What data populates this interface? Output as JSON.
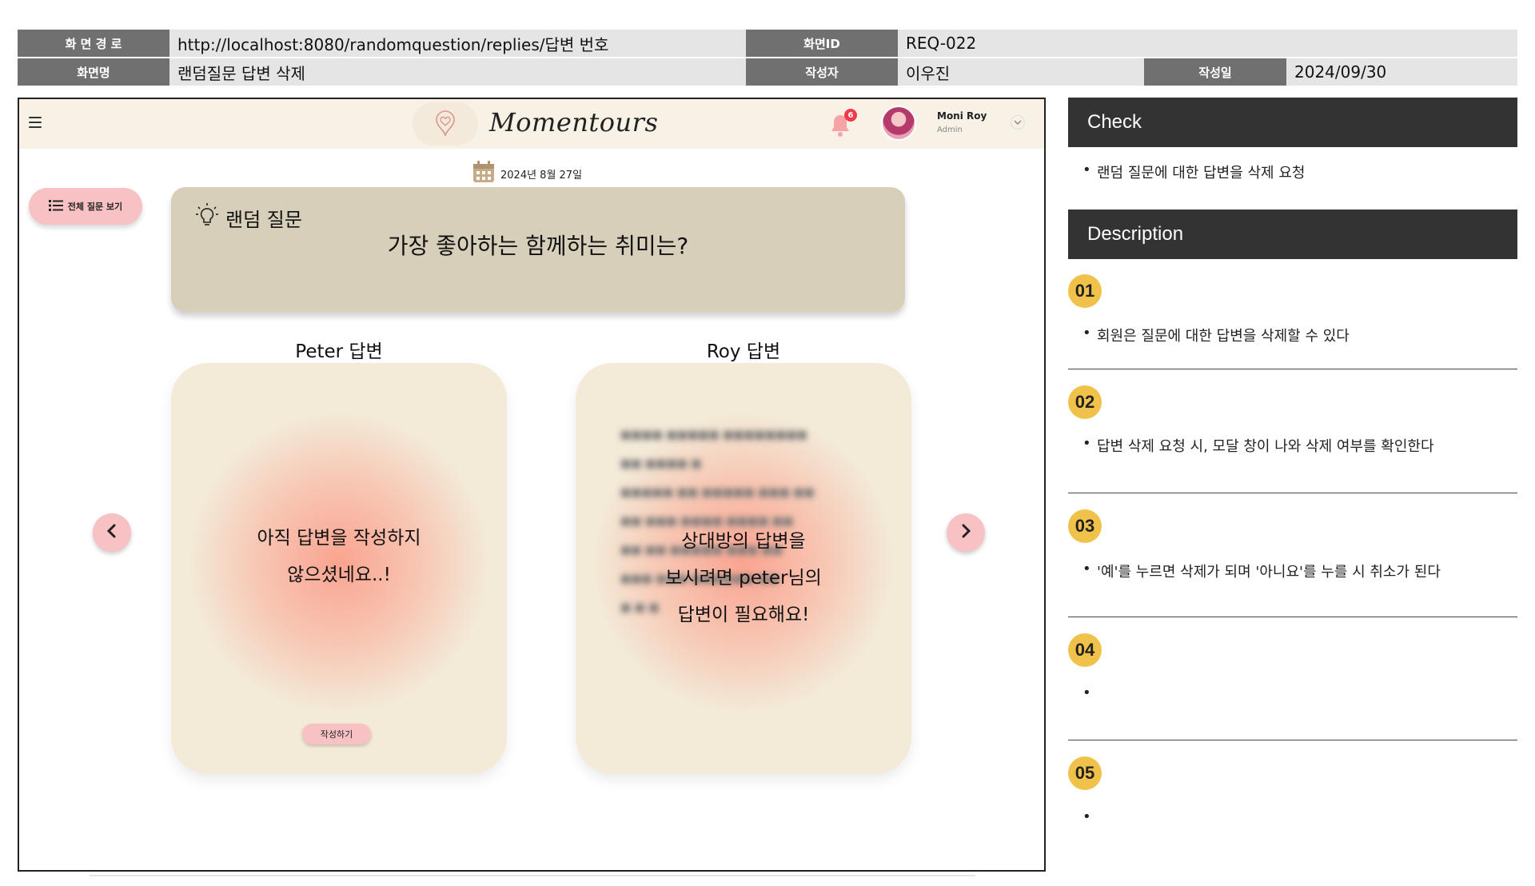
{
  "doc_header": {
    "path_label": "화 면 경 로",
    "path_value": "http://localhost:8080/randomquestion/replies/답변 번호",
    "screen_id_label": "화면ID",
    "screen_id_value": "REQ-022",
    "screen_name_label": "화면명",
    "screen_name_value": "랜덤질문 답변 삭제",
    "author_label": "작성자",
    "author_value": "이우진",
    "date_label": "작성일",
    "date_value": "2024/09/30"
  },
  "app": {
    "brand": "Momentours",
    "notification_count": "6",
    "user": {
      "name": "Moni Roy",
      "role": "Admin"
    },
    "date": "2024년 8월 27일",
    "list_button": "전체 질문 보기",
    "question": {
      "label": "랜덤 질문",
      "text": "가장 좋아하는 함께하는 취미는?"
    },
    "answers": [
      {
        "title": "Peter 답변",
        "message_lines": [
          "아직 답변을 작성하지",
          "않으셨네요..!"
        ],
        "action": "작성하기"
      },
      {
        "title": "Roy 답변",
        "message_lines": [
          "상대방의 답변을",
          "보시려면 peter님의",
          "답변이 필요해요!"
        ]
      }
    ]
  },
  "panel": {
    "check_title": "Check",
    "check_items": [
      "랜덤 질문에 대한 답변을 삭제 요청"
    ],
    "description_title": "Description",
    "items": [
      {
        "num": "01",
        "text": "회원은 질문에 대한 답변을 삭제할 수 있다"
      },
      {
        "num": "02",
        "text": "답변 삭제 요청 시, 모달 창이 나와 삭제 여부를 확인한다"
      },
      {
        "num": "03",
        "text": "'예'를 누르면 삭제가 되며 '아니요'를 누를 시 취소가 된다"
      },
      {
        "num": "04",
        "text": ""
      },
      {
        "num": "05",
        "text": ""
      }
    ]
  },
  "colors": {
    "nav_bg": "#f7f1e6",
    "question_bg": "#d7cfba",
    "card_bg": "#f3ead8",
    "pink_button": "#f8c2c4",
    "panel_header": "#333333",
    "badge_yellow": "#f0c24a",
    "header_label": "#707070",
    "header_value": "#e5e5e5"
  },
  "icons": [
    "hamburger-icon",
    "logo-icon",
    "bell-icon",
    "chevron-down-icon",
    "calendar-icon",
    "list-icon",
    "lightbulb-icon",
    "chevron-left-icon",
    "chevron-right-icon"
  ]
}
